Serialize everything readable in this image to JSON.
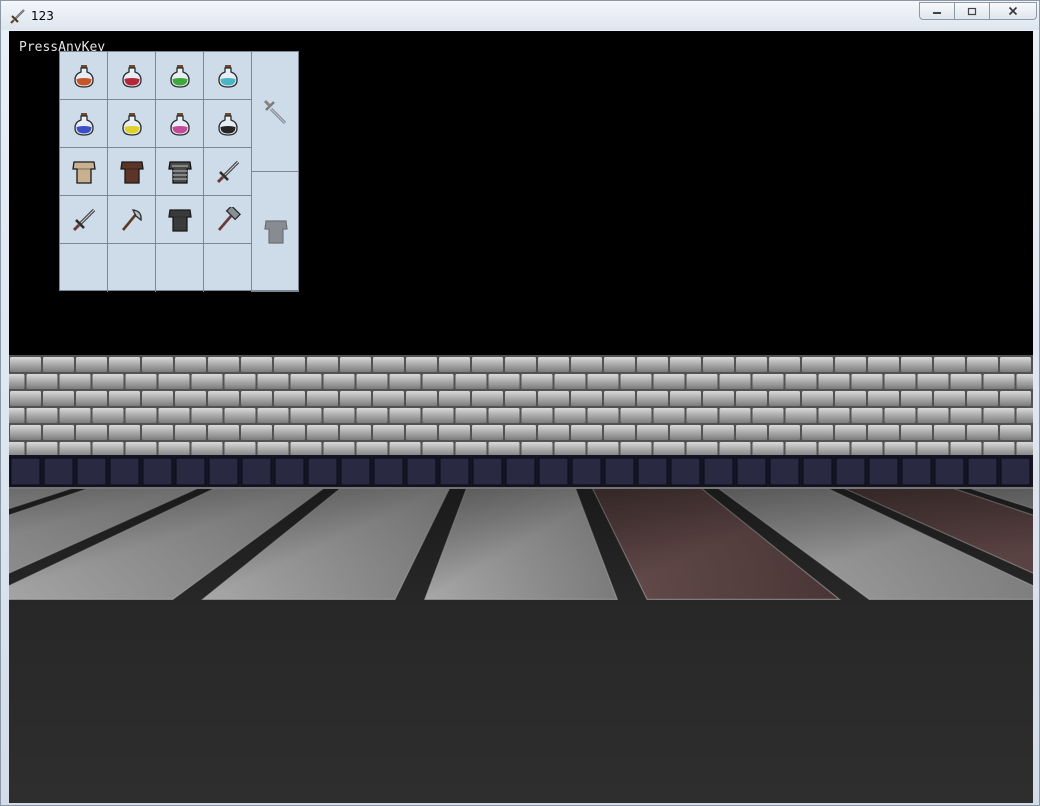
{
  "window": {
    "title": "123",
    "icon": "sword-icon",
    "controls": [
      "minimize-icon",
      "maximize-icon",
      "close-icon"
    ]
  },
  "game": {
    "hint": "PressAnyKey"
  },
  "inventory": {
    "slots": [
      {
        "item": "potion",
        "color": "#c8552a"
      },
      {
        "item": "potion",
        "color": "#b4283a"
      },
      {
        "item": "potion",
        "color": "#3fa83c"
      },
      {
        "item": "potion",
        "color": "#48b6c4"
      },
      {
        "item": "potion",
        "color": "#3c50c8"
      },
      {
        "item": "potion",
        "color": "#e0d028"
      },
      {
        "item": "potion",
        "color": "#c64a9a"
      },
      {
        "item": "potion",
        "color": "#262626"
      },
      {
        "item": "tunic",
        "color": "#c9b190"
      },
      {
        "item": "tunic",
        "color": "#5a3528"
      },
      {
        "item": "chainmail",
        "color": "#4a4a4a"
      },
      {
        "item": "sword",
        "color": "#404040"
      },
      {
        "item": "sword",
        "color": "#404040"
      },
      {
        "item": "axe",
        "color": "#404040"
      },
      {
        "item": "tunic",
        "color": "#3a3a3a"
      },
      {
        "item": "hammer",
        "color": "#404040"
      },
      {
        "item": "empty"
      },
      {
        "item": "empty"
      },
      {
        "item": "empty"
      },
      {
        "item": "empty"
      }
    ],
    "equipped": [
      {
        "slot": "weapon",
        "item": "sword"
      },
      {
        "slot": "armor",
        "item": "tunic"
      }
    ]
  }
}
